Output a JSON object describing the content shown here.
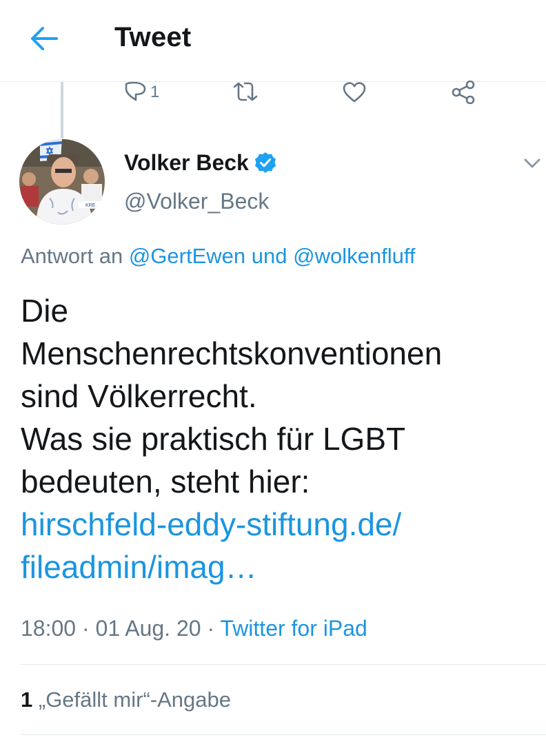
{
  "header": {
    "title": "Tweet"
  },
  "parent_actions": {
    "reply_count": "1"
  },
  "author": {
    "name": "Volker Beck",
    "handle": "@Volker_Beck"
  },
  "reply_to": {
    "prefix": "Antwort an",
    "user1": "@GertEwen",
    "conjunction": "und",
    "user2": "@wolkenfluff"
  },
  "tweet": {
    "lines": [
      "Die",
      "Menschenrechtskonventionen",
      "sind Völkerrecht.",
      "Was sie praktisch für LGBT",
      "bedeuten, steht hier:"
    ],
    "link_lines": [
      "hirschfeld-eddy-stiftung.de/",
      "fileadmin/imag…"
    ]
  },
  "meta": {
    "time": "18:00",
    "separator": "·",
    "date": "01 Aug. 20",
    "source": "Twitter for iPad"
  },
  "stats": {
    "likes_count": "1",
    "likes_label": "„Gefällt mir“-Angabe"
  },
  "colors": {
    "accent": "#1b95e0",
    "text": "#14171a",
    "muted": "#657786",
    "verified": "#1da1f2"
  }
}
